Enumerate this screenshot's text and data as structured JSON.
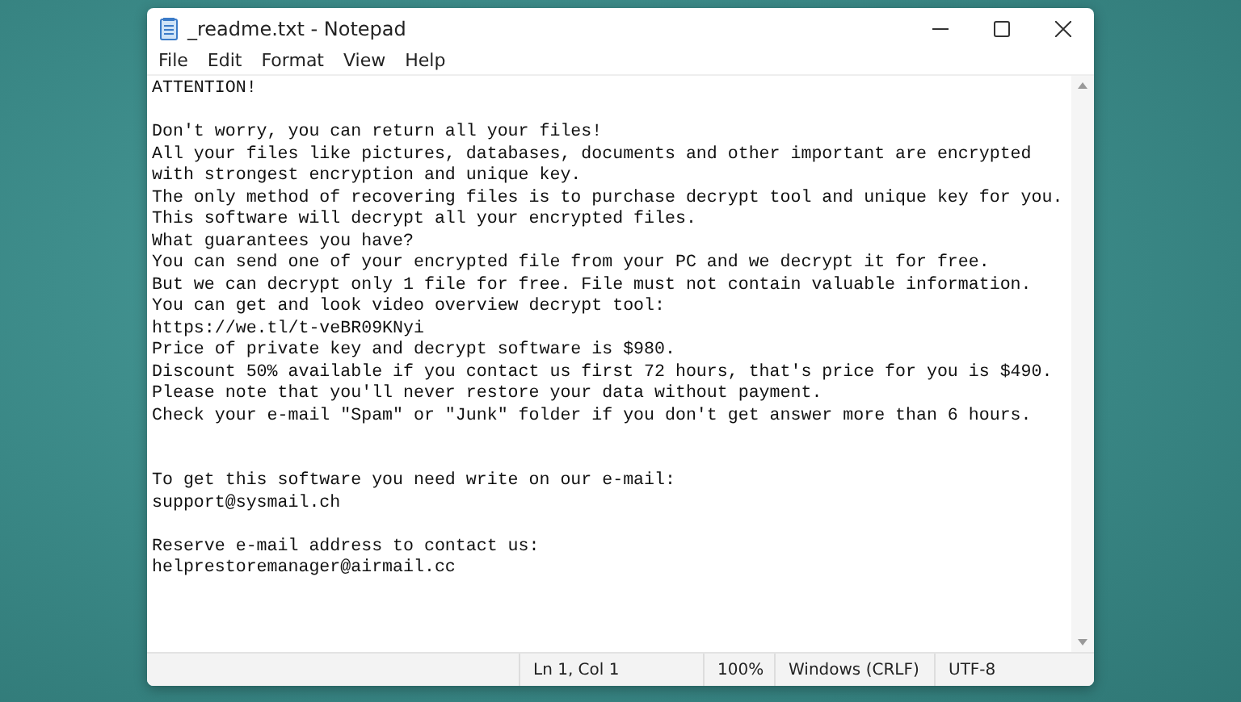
{
  "window": {
    "title": "_readme.txt - Notepad"
  },
  "menu": [
    "File",
    "Edit",
    "Format",
    "View",
    "Help"
  ],
  "document": {
    "blocks": [
      {
        "kind": "heading",
        "lines": [
          "ATTENTION!"
        ]
      },
      {
        "kind": "paragraph",
        "lines": [
          "Don't worry, you can return all your files!",
          "All your files like pictures, databases, documents and other important are encrypted",
          "with strongest encryption and unique key.",
          "The only method of recovering files is to purchase decrypt tool and unique key for you.",
          "This software will decrypt all your encrypted files.",
          "What guarantees you have?",
          "You can send one of your encrypted file from your PC and we decrypt it for free.",
          "But we can decrypt only 1 file for free. File must not contain valuable information.",
          "You can get and look video overview decrypt tool:",
          "https://we.tl/t-veBR09KNyi",
          "Price of private key and decrypt software is $980.",
          "Discount 50% available if you contact us first 72 hours, that's price for you is $490.",
          "Please note that you'll never restore your data without payment.",
          "Check your e-mail \"Spam\" or \"Junk\" folder if you don't get answer more than 6 hours."
        ]
      },
      {
        "kind": "section",
        "lines": [
          "To get this software you need write on our e-mail:",
          "support@sysmail.ch"
        ]
      },
      {
        "kind": "paragraph",
        "lines": [
          "Reserve e-mail address to contact us:",
          "helprestoremanager@airmail.cc"
        ]
      }
    ]
  },
  "status_bar": {
    "position": "Ln 1, Col 1",
    "zoom": "100%",
    "line_ending": "Windows (CRLF)",
    "encoding": "UTF-8"
  }
}
